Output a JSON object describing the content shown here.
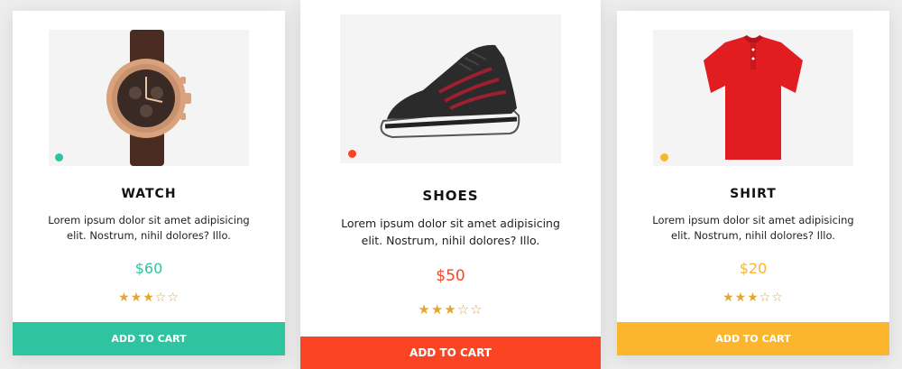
{
  "products": [
    {
      "name": "WATCH",
      "description_line1": "Lorem ipsum dolor sit amet adipisicing",
      "description_line2": "elit. Nostrum, nihil dolores? Illo.",
      "price": "$60",
      "rating_stars": "★★★☆☆",
      "rating": 3,
      "rating_max": 5,
      "button_label": "ADD TO CART",
      "accent_color": "#2ec4a0",
      "image_icon": "watch-icon"
    },
    {
      "name": "SHOES",
      "description_line1": "Lorem ipsum dolor sit amet adipisicing",
      "description_line2": "elit. Nostrum, nihil dolores? Illo.",
      "price": "$50",
      "rating_stars": "★★★☆☆",
      "rating": 3,
      "rating_max": 5,
      "button_label": "ADD TO CART",
      "accent_color": "#fb4424",
      "image_icon": "shoe-icon"
    },
    {
      "name": "SHIRT",
      "description_line1": "Lorem ipsum dolor sit amet adipisicing",
      "description_line2": "elit. Nostrum, nihil dolores? Illo.",
      "price": "$20",
      "rating_stars": "★★★☆☆",
      "rating": 3,
      "rating_max": 5,
      "button_label": "ADD TO CART",
      "accent_color": "#fbb62e",
      "image_icon": "shirt-icon"
    }
  ]
}
